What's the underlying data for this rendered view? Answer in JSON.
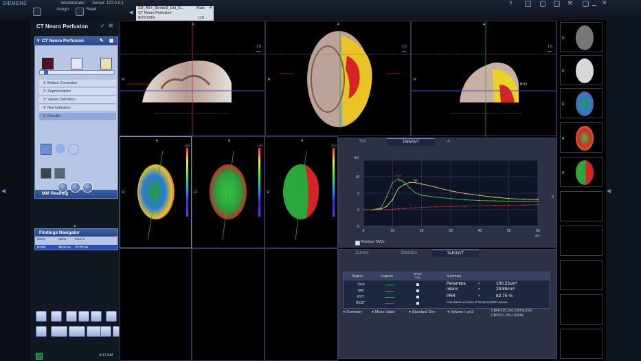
{
  "topbar": {
    "brand": "SIEMENS",
    "user": "Administrator",
    "server": "Server: 127.0.0.1",
    "assign_label": "Assign",
    "read_label": "Read",
    "patient": {
      "name": "SD_AS+_Strobe3_Uni_G...",
      "sex": "Male",
      "study": "CT Neuro Perfusion",
      "dob": "8/25/1962",
      "id": "118"
    }
  },
  "leftpanel": {
    "title": "CT Neuro Perfusion",
    "workflow_title": "CT Neuro Perfusion",
    "slider_label": "DBs",
    "steps": [
      "1: Motion Correction",
      "2: Segmentation",
      "3: Vessel Definition",
      "4: Normalization",
      "5: Results"
    ],
    "mm_reading": "MM Reading",
    "findings": {
      "title": "Findings Navigator",
      "columns": [
        "Name",
        "Value",
        "Source"
      ],
      "row": {
        "name": "ROI01",
        "value": "39.02 mL",
        "source": "CT-PF-NI"
      }
    },
    "clock": "4:17 AM"
  },
  "viewports": {
    "top_left": {
      "top": "A",
      "left": "R",
      "scale": "1.5",
      "unit": "mm"
    },
    "top_mid": {
      "top": "A",
      "left": "R",
      "scale": "1.5",
      "unit": "mm"
    },
    "top_right": {
      "top": "A",
      "left": "R",
      "right": "BOX",
      "scale": "1.5",
      "unit": "mm"
    },
    "mid": [
      {
        "top": "A",
        "left": "R",
        "scale_top": "100"
      },
      {
        "top": "A",
        "left": "R",
        "scale_top": "4.00"
      },
      {
        "top": "A",
        "left": "R",
        "scale_top": "10.0"
      }
    ]
  },
  "tac": {
    "tabs": [
      "TAC",
      "TAR/NVT",
      "A"
    ],
    "selected_tab": "TAR/NVT",
    "checkbox_label": "Relative TACs",
    "checkbox_checked": true,
    "series_labels": {
      "rest": "REST",
      "nvt": "NVT",
      "tar": "TAR"
    },
    "right_end_label": "0"
  },
  "chart_data": {
    "type": "line",
    "ylabel": "HU",
    "xlabel": "sec",
    "xlim": [
      0,
      60
    ],
    "ylim": [
      -5,
      15
    ],
    "xticks": [
      0,
      10,
      20,
      30,
      40,
      50,
      60
    ],
    "yticks": [
      -5,
      0,
      5,
      10
    ],
    "series": [
      {
        "name": "REST",
        "color": "#d8d85a",
        "x": [
          0,
          3,
          6,
          8,
          10,
          12,
          14,
          16,
          18,
          20,
          25,
          30,
          35,
          40,
          45,
          50,
          55,
          60
        ],
        "values": [
          0,
          0,
          0.2,
          1,
          3,
          6.5,
          7.6,
          8.3,
          8.2,
          7.8,
          6.8,
          5.7,
          4.9,
          4.3,
          3.8,
          3.4,
          3.2,
          3.1
        ]
      },
      {
        "name": "NVT",
        "color": "#47c453",
        "x": [
          0,
          3,
          6,
          8,
          10,
          12,
          14,
          16,
          18,
          20,
          25,
          30,
          35,
          40,
          45,
          50,
          55,
          60
        ],
        "values": [
          0,
          0,
          0.5,
          4,
          8.2,
          9.4,
          8.3,
          6.5,
          5.1,
          4.4,
          3.8,
          3.4,
          3.0,
          2.8,
          2.7,
          2.6,
          2.5,
          2.5
        ]
      },
      {
        "name": "TAR",
        "color": "#d23b3b",
        "x": [
          0,
          3,
          6,
          8,
          10,
          12,
          14,
          16,
          18,
          20,
          25,
          30,
          35,
          40,
          45,
          50,
          55,
          60
        ],
        "values": [
          0,
          0,
          0,
          0,
          0.1,
          0.3,
          0.4,
          0.5,
          0.6,
          0.7,
          0.9,
          1.0,
          1.1,
          1.2,
          1.3,
          1.3,
          1.4,
          1.5
        ]
      }
    ]
  },
  "stats": {
    "tabs": [
      "Curves",
      "Statistics",
      "TAR/NVT"
    ],
    "selected_tab": "TAR/NVT",
    "headers": {
      "region": "Region",
      "legend": "Legend",
      "show": "Show TAC",
      "summary": "Summary"
    },
    "rows": [
      {
        "region": "Total",
        "color": "#2aa84a"
      },
      {
        "region": "TAR",
        "color": "#2aa84a"
      },
      {
        "region": "NVT",
        "color": "#2aa84a"
      },
      {
        "region": "REST",
        "color": "#7a3aa8"
      }
    ],
    "summary": {
      "penumbra_label": "Penumbra",
      "penumbra_value": "100.23cm³",
      "infarct_label": "Infarct",
      "infarct_value": "20.89cm³",
      "prr_label": "PRR",
      "prr_value": "82.75 %",
      "note": "Calculated on basis of Temporal MIP volume",
      "eq": "="
    },
    "options": [
      "Summary",
      "Mean Value",
      "Standard Dev",
      "Volume / cm3"
    ],
    "thresholds": [
      "CBFD<35.1mL/100mL/min",
      "CBVD<1.2mL/100mL"
    ]
  },
  "thumbnails": {
    "labels": [
      "R",
      "R",
      "R",
      "R",
      "R"
    ]
  },
  "colors": {
    "accent": "#3a5ea8",
    "panel": "#b8c6e6"
  }
}
